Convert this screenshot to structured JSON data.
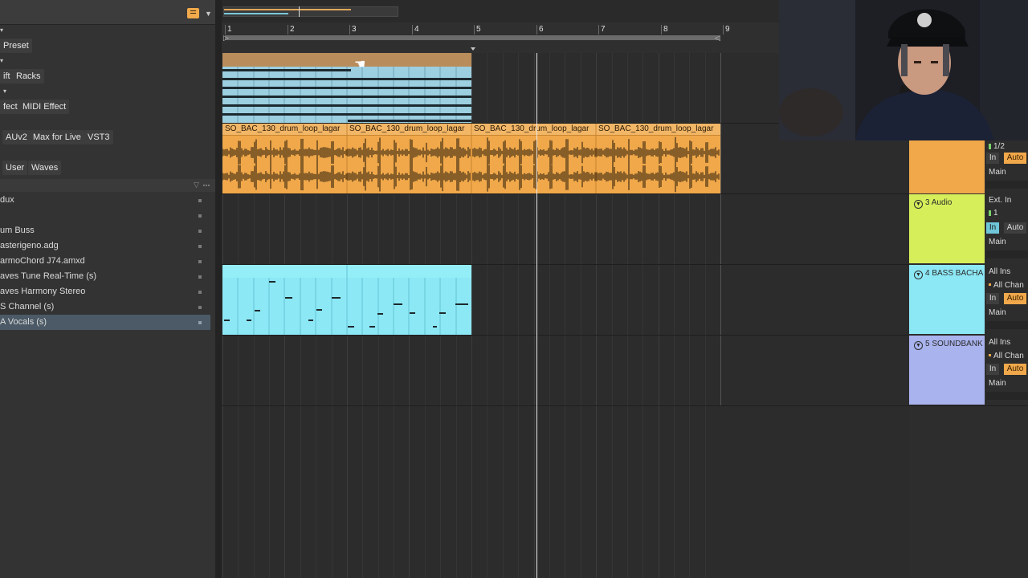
{
  "browser": {
    "tag_rows": [
      [
        "Preset"
      ],
      [
        "ift",
        "Racks"
      ],
      [
        "fect",
        "MIDI Effect"
      ],
      [
        "AUv2",
        "Max for Live",
        "VST3"
      ],
      [
        "User",
        "Waves"
      ]
    ],
    "files": [
      "dux",
      "",
      "um Buss",
      "asterigeno.adg",
      "armoChord J74.amxd",
      "aves Tune Real-Time (s)",
      "aves Harmony Stereo",
      "S Channel (s)",
      "A Vocals (s)"
    ]
  },
  "ruler": {
    "bars": [
      "1",
      "2",
      "3",
      "4",
      "5",
      "6",
      "7",
      "8",
      "9"
    ]
  },
  "clips": {
    "drum_names": [
      "SO_BAC_130_drum_loop_lagar",
      "SO_BAC_130_drum_loop_lagar",
      "SO_BAC_130_drum_loop_lagar",
      "SO_BAC_130_drum_loop_lagar"
    ]
  },
  "tracks": {
    "t2": {
      "io_top": "1/2",
      "in": "In",
      "auto": "Auto",
      "out": "Main",
      "color": "#f0a84a"
    },
    "t3": {
      "name": "3 Audio",
      "io_top": "Ext. In",
      "io_sub": "1",
      "in": "In",
      "auto": "Auto",
      "out": "Main",
      "color": "#d6ee5a"
    },
    "t4": {
      "name": "4 BASS BACHA",
      "io_top": "All Ins",
      "io_sub": "All Chan",
      "in": "In",
      "auto": "Auto",
      "out": "Main",
      "color": "#8de8f5"
    },
    "t5": {
      "name": "5 SOUNDBANK",
      "io_top": "All Ins",
      "io_sub": "All Chan",
      "in": "In",
      "auto": "Auto",
      "out": "Main",
      "color": "#a9b3ee"
    }
  },
  "colors": {
    "accent": "#f0a84a",
    "clip_blue": "#9ccfe0",
    "clip_cyan": "#8de8f5"
  }
}
